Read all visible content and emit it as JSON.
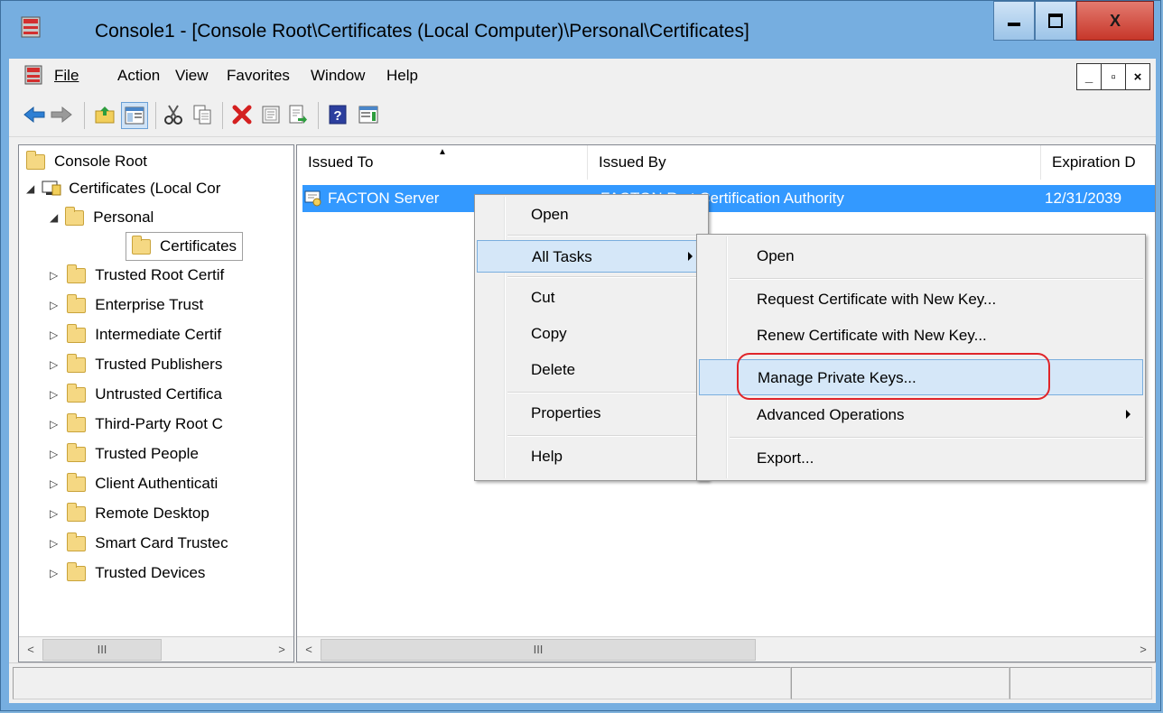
{
  "window": {
    "title": "Console1 - [Console Root\\Certificates (Local Computer)\\Personal\\Certificates]",
    "minimize_label": "▬",
    "maximize_label": "▢",
    "close_label": "X"
  },
  "menubar": {
    "items": [
      "File",
      "Action",
      "View",
      "Favorites",
      "Window",
      "Help"
    ]
  },
  "mdi": {
    "min": "_",
    "restore": "▫",
    "close": "×"
  },
  "toolbar": {
    "icons": [
      "back-arrow-icon",
      "forward-arrow-icon",
      "up-folder-icon",
      "show-hide-tree-icon",
      "cut-icon",
      "copy-icon",
      "delete-icon",
      "properties-icon",
      "export-icon",
      "help-icon",
      "action-pane-icon"
    ]
  },
  "tree": {
    "root": "Console Root",
    "certificates": "Certificates (Local Cor",
    "personal": "Personal",
    "personal_certificates": "Certificates",
    "stores": [
      "Trusted Root Certif",
      "Enterprise Trust",
      "Intermediate Certif",
      "Trusted Publishers",
      "Untrusted Certifica",
      "Third-Party Root C",
      "Trusted People",
      "Client Authenticati",
      "Remote Desktop",
      "Smart Card Trustec",
      "Trusted Devices"
    ]
  },
  "list": {
    "columns": [
      "Issued To",
      "Issued By",
      "Expiration D"
    ],
    "rows": [
      {
        "issued_to": "FACTON Server",
        "issued_by": "FACTON R ot Certification Authority",
        "expiration": "12/31/2039"
      }
    ]
  },
  "context_menu": {
    "items": [
      "Open",
      "All Tasks",
      "Cut",
      "Copy",
      "Delete",
      "Properties",
      "Help"
    ]
  },
  "submenu": {
    "items": [
      "Open",
      "Request Certificate with New Key...",
      "Renew Certificate with New Key...",
      "Manage Private Keys...",
      "Advanced Operations",
      "Export..."
    ]
  },
  "scroll": {
    "left": "<",
    "right": ">",
    "thumb": "III"
  },
  "colors": {
    "selection": "#3399ff",
    "highlight_ring": "#e0252a",
    "menu_hover": "#d5e7f8"
  }
}
